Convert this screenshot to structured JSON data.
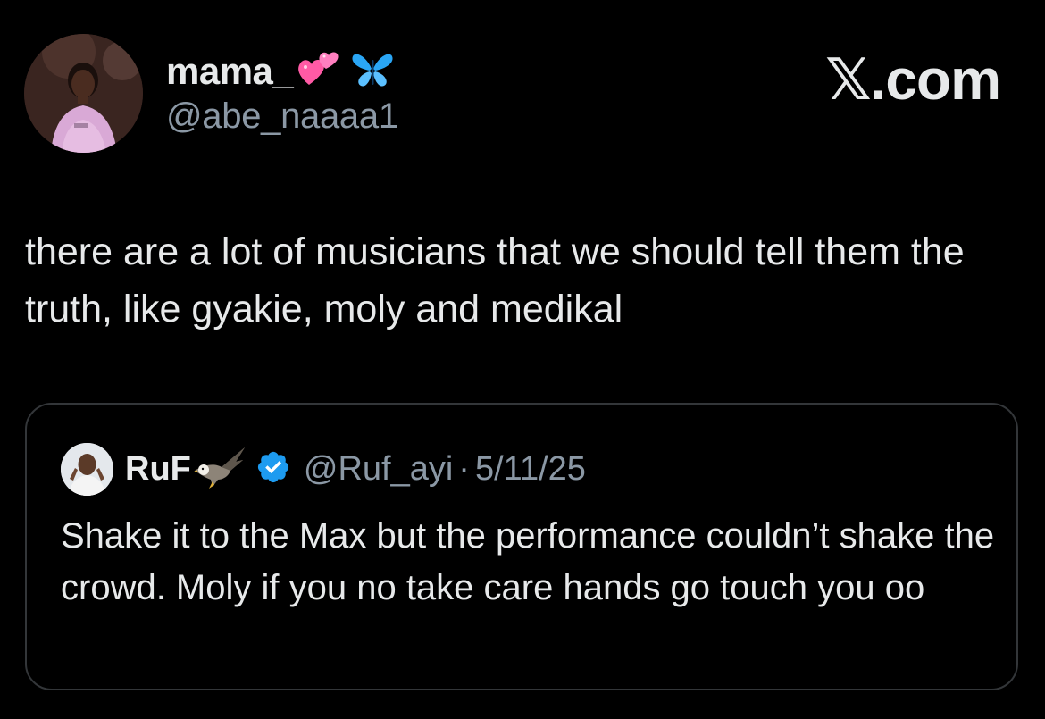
{
  "author": {
    "display_name": "mama_",
    "emoji_hearts": "💕",
    "emoji_butterfly": "🦋",
    "handle": "@abe_naaaa1"
  },
  "brand": {
    "label": "𝕏.com"
  },
  "tweet": {
    "text": "there are a lot of musicians that we should tell them the truth, like gyakie, moly and medikal"
  },
  "quoted_tweet": {
    "display_name": "RuF",
    "emoji_eagle": "🦅",
    "verified": true,
    "handle": "@Ruf_ayi",
    "separator": "·",
    "date": "5/11/25",
    "text": "Shake it to the Max but the performance couldn’t shake the crowd. Moly if you no take care hands go touch you oo"
  },
  "icons": {
    "verified": "verified-badge-icon",
    "brand": "x-logo-icon"
  },
  "colors": {
    "background": "#000000",
    "primary_text": "#e7e9ea",
    "secondary_text": "#8b98a5",
    "verified_blue": "#1d9bf0",
    "card_border": "#333639"
  }
}
